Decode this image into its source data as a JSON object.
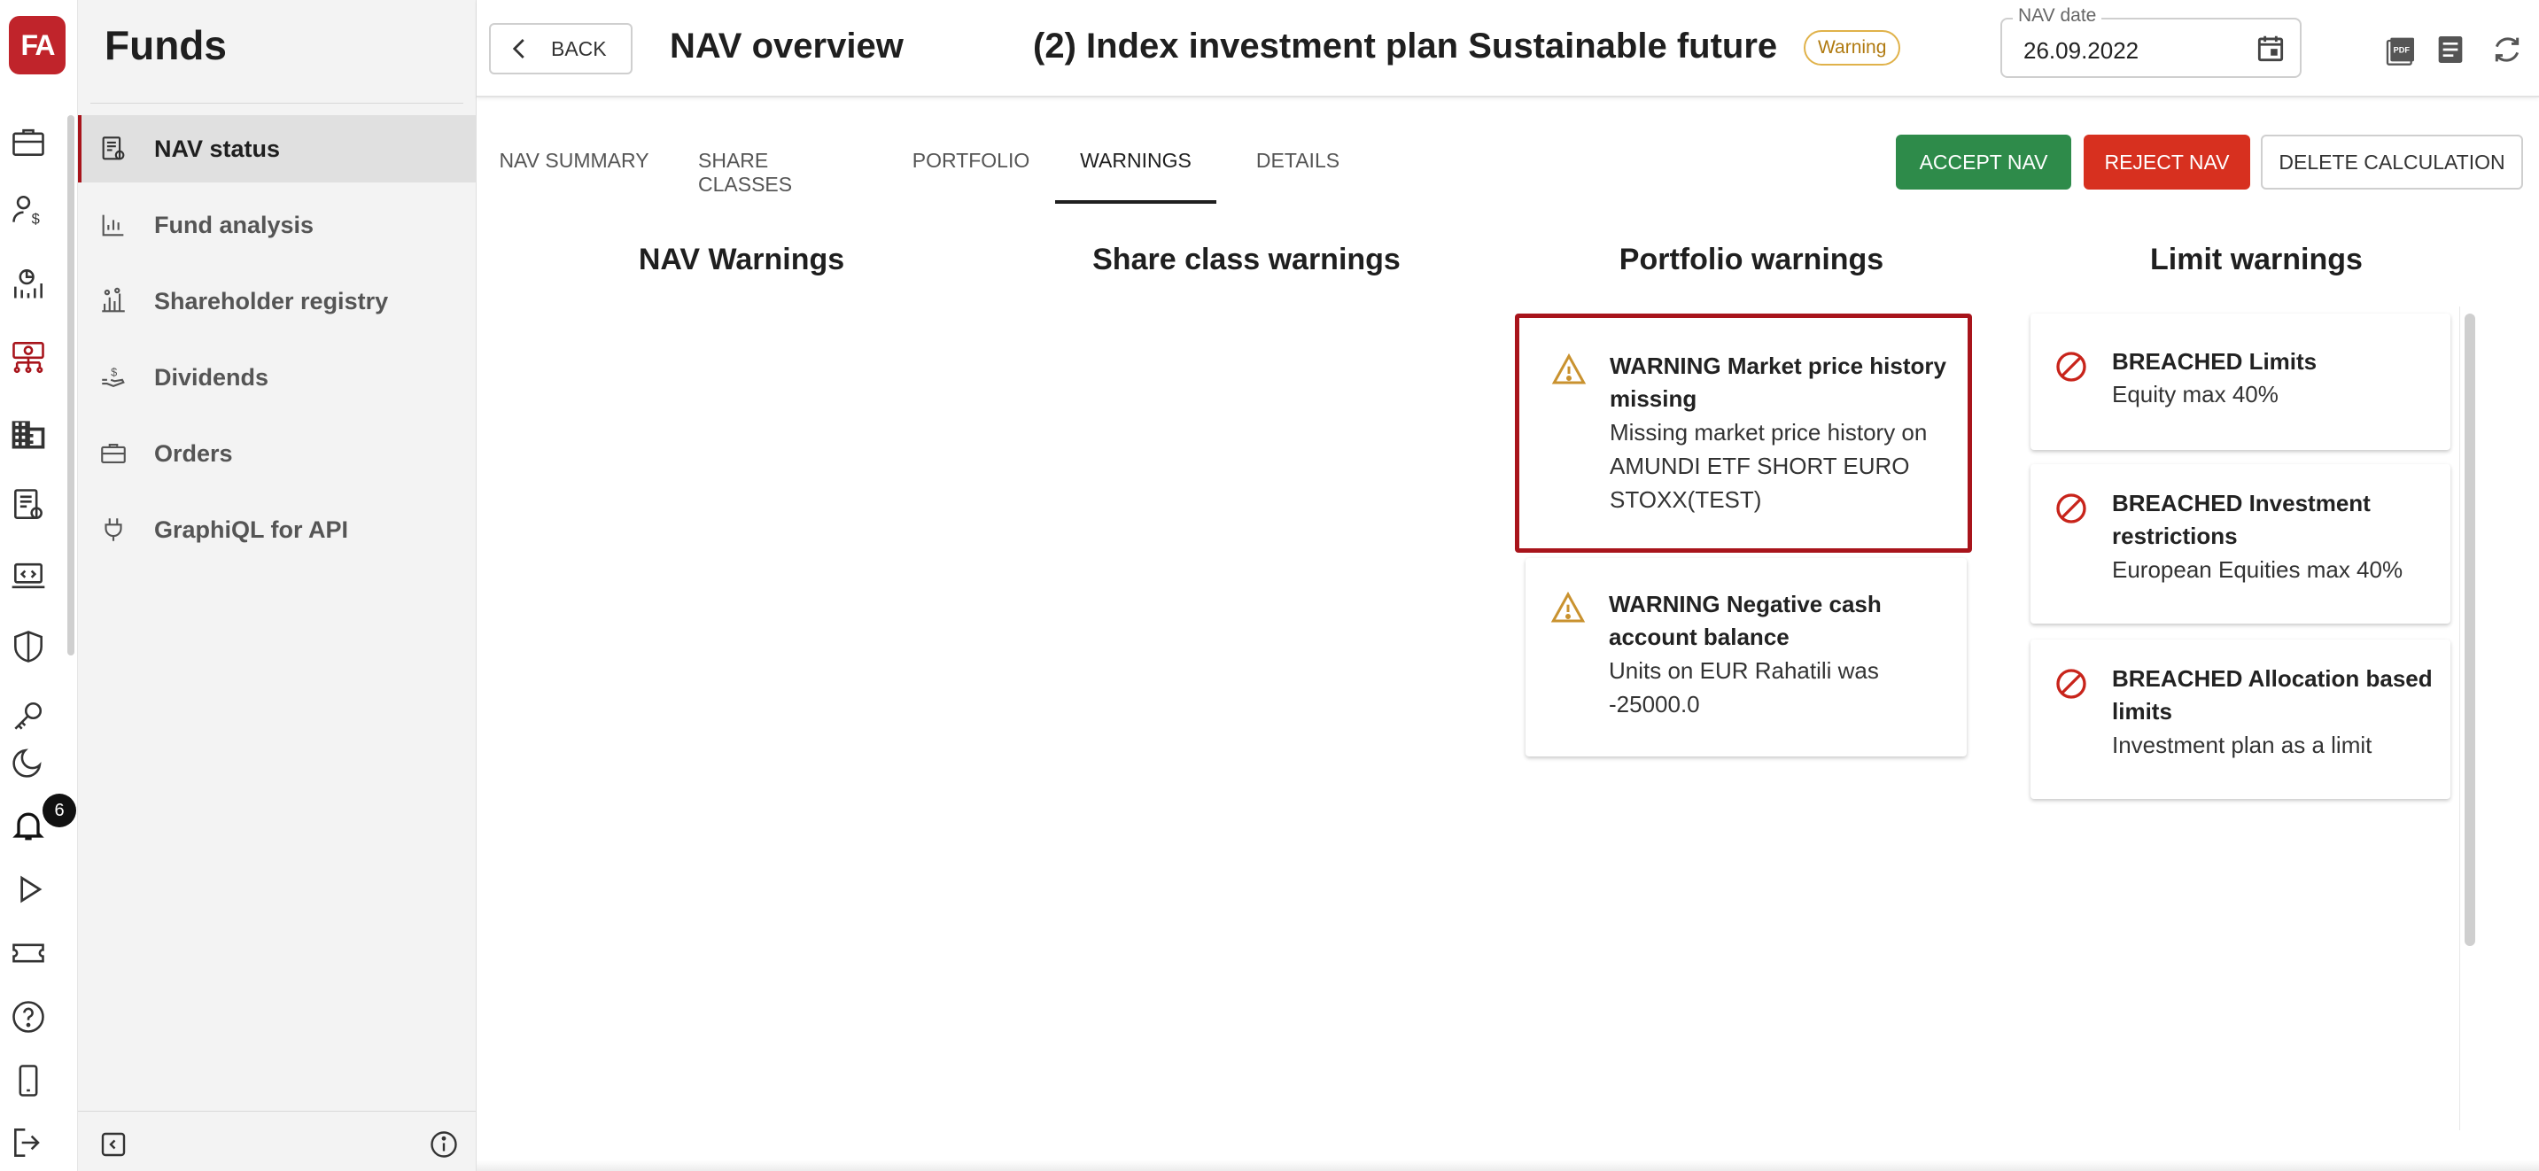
{
  "app": {
    "logo_text": "FA",
    "brand_color": "#c0242b"
  },
  "rail": {
    "icons": [
      "briefcase-icon",
      "client-dollar-icon",
      "report-chart-icon",
      "funds-icon",
      "building-icon",
      "admin-settings-icon",
      "code-laptop-icon",
      "shield-icon",
      "key-icon",
      "dark-mode-icon",
      "bell-icon",
      "play-icon",
      "ticket-icon",
      "help-icon",
      "mobile-icon",
      "logout-icon"
    ],
    "notification_count": "6"
  },
  "sidenav": {
    "title": "Funds",
    "items": [
      {
        "label": "NAV status",
        "icon": "nav-status-icon",
        "active": true
      },
      {
        "label": "Fund analysis",
        "icon": "bar-chart-icon"
      },
      {
        "label": "Shareholder registry",
        "icon": "registry-icon"
      },
      {
        "label": "Dividends",
        "icon": "dividend-hand-icon"
      },
      {
        "label": "Orders",
        "icon": "briefcase-icon"
      },
      {
        "label": "GraphiQL for API",
        "icon": "plug-icon"
      }
    ]
  },
  "header": {
    "back_label": "BACK",
    "title": "NAV overview",
    "fund_name": "(2) Index investment plan Sustainable future",
    "status_badge": "Warning",
    "nav_date_label": "NAV date",
    "nav_date_value": "26.09.2022"
  },
  "tabs": [
    {
      "label": "NAV SUMMARY"
    },
    {
      "label": "SHARE CLASSES"
    },
    {
      "label": "PORTFOLIO"
    },
    {
      "label": "WARNINGS",
      "active": true
    },
    {
      "label": "DETAILS"
    }
  ],
  "actions": {
    "accept": "ACCEPT NAV",
    "reject": "REJECT NAV",
    "delete": "DELETE CALCULATION",
    "accept_color": "#2e8b4a",
    "reject_color": "#d7301f"
  },
  "columns": {
    "nav": {
      "title": "NAV Warnings"
    },
    "share_class": {
      "title": "Share class warnings"
    },
    "portfolio": {
      "title": "Portfolio warnings",
      "cards": [
        {
          "title_lines": [
            "WARNING Market price history",
            "missing"
          ],
          "body_lines": [
            "Missing market price history on",
            "AMUNDI ETF SHORT EURO",
            "STOXX(TEST)"
          ],
          "icon": "warning-triangle-icon"
        },
        {
          "title_lines": [
            "WARNING Negative cash",
            "account balance"
          ],
          "body_lines": [
            "Units on EUR Rahatili was",
            "-25000.0"
          ],
          "icon": "warning-triangle-icon"
        }
      ]
    },
    "limit": {
      "title": "Limit warnings",
      "cards": [
        {
          "title_lines": [
            "BREACHED Limits"
          ],
          "body_lines": [
            "Equity max 40%"
          ],
          "icon": "prohibited-icon"
        },
        {
          "title_lines": [
            "BREACHED Investment",
            "restrictions"
          ],
          "body_lines": [
            "European Equities max 40%"
          ],
          "icon": "prohibited-icon"
        },
        {
          "title_lines": [
            "BREACHED Allocation based",
            "limits"
          ],
          "body_lines": [
            "Investment plan as a limit"
          ],
          "icon": "prohibited-icon"
        }
      ]
    }
  }
}
